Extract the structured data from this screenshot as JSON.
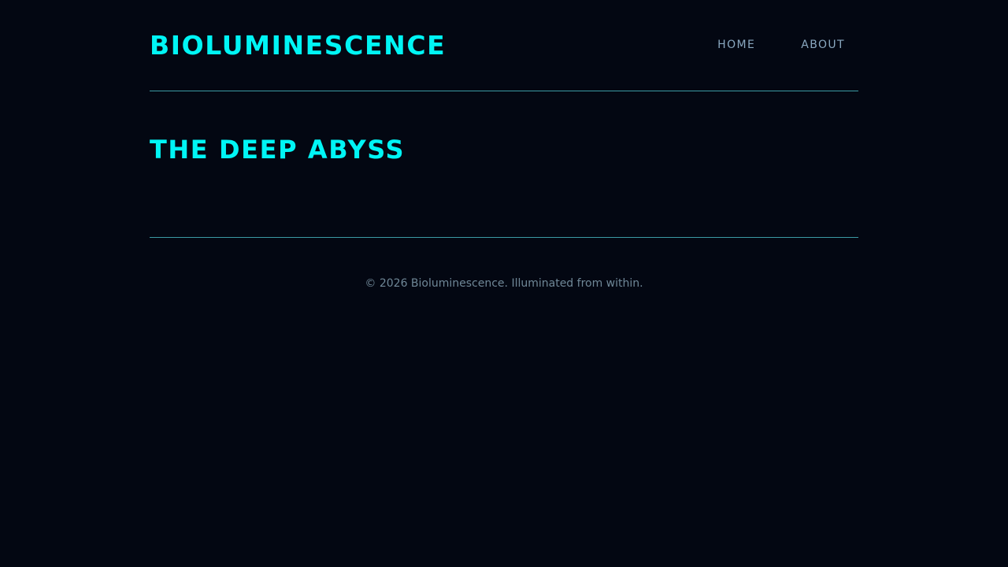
{
  "header": {
    "site_title": "BIOLUMINESCENCE",
    "nav": [
      {
        "label": "HOME"
      },
      {
        "label": "ABOUT"
      }
    ]
  },
  "main": {
    "page_title": "THE DEEP ABYSS"
  },
  "footer": {
    "text": "© 2026 Bioluminescence. Illuminated from within."
  },
  "colors": {
    "background": "#030712",
    "accent": "#00f5f5",
    "nav_text": "#8aa8c0",
    "divider": "#3b9aa3",
    "footer_text": "#6f8797"
  }
}
